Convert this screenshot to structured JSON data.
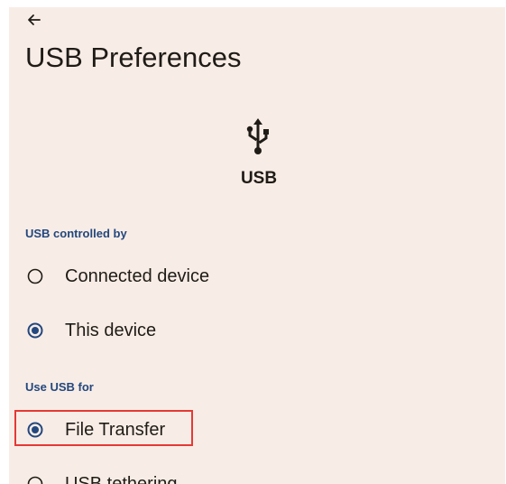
{
  "header": {
    "back_icon": "arrow-back-icon",
    "title": "USB Preferences"
  },
  "hero": {
    "icon": "usb-icon",
    "label": "USB"
  },
  "sections": {
    "controlled_by": {
      "header": "USB controlled by",
      "options": [
        {
          "label": "Connected device",
          "selected": false
        },
        {
          "label": "This device",
          "selected": true
        }
      ]
    },
    "use_for": {
      "header": "Use USB for",
      "options": [
        {
          "label": "File Transfer",
          "selected": true
        },
        {
          "label": "USB tethering",
          "selected": false
        }
      ]
    }
  },
  "colors": {
    "background": "#f8ede6",
    "accent": "#23477e",
    "text": "#1f1b16",
    "highlight_border": "#e53935"
  }
}
